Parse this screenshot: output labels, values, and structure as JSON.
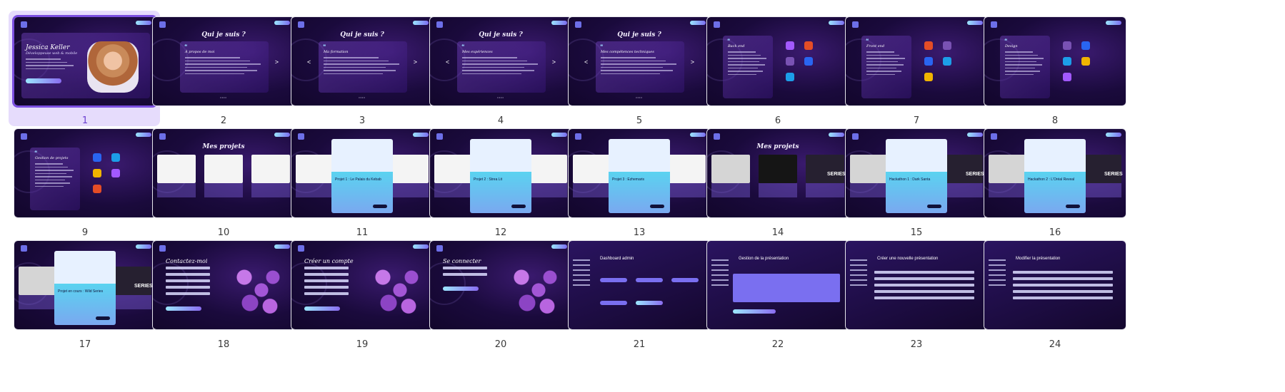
{
  "slides": [
    {
      "number": "1",
      "kind": "hero",
      "selected": true
    },
    {
      "number": "2",
      "kind": "about",
      "title": "Qui je suis ?",
      "heading": "À propos de moi"
    },
    {
      "number": "3",
      "kind": "about",
      "title": "Qui je suis ?",
      "heading": "Ma formation"
    },
    {
      "number": "4",
      "kind": "about",
      "title": "Qui je suis ?",
      "heading": "Mes expériences"
    },
    {
      "number": "5",
      "kind": "about",
      "title": "Qui je suis ?",
      "heading": "Mes compétences techniques"
    },
    {
      "number": "6",
      "kind": "skills",
      "heading": "Back end"
    },
    {
      "number": "7",
      "kind": "skills",
      "heading": "Front end"
    },
    {
      "number": "8",
      "kind": "skills",
      "heading": "Design"
    },
    {
      "number": "9",
      "kind": "skills",
      "heading": "Gestion de projets"
    },
    {
      "number": "10",
      "kind": "projects",
      "title": "Mes projets"
    },
    {
      "number": "11",
      "kind": "modal",
      "heading": "Projet 1 : Le Palais du Kebab"
    },
    {
      "number": "12",
      "kind": "modal",
      "heading": "Projet 2 : Strea Lit"
    },
    {
      "number": "13",
      "kind": "modal",
      "heading": "Projet 3 : Ezhemaris"
    },
    {
      "number": "14",
      "kind": "projects",
      "title": "Mes projets"
    },
    {
      "number": "15",
      "kind": "modal",
      "heading": "Hackathon 1 : Dark Santa"
    },
    {
      "number": "16",
      "kind": "modal",
      "heading": "Hackathon 2 : L'Oréal Reveal"
    },
    {
      "number": "17",
      "kind": "modal",
      "heading": "Projet en cours : Wild Series"
    },
    {
      "number": "18",
      "kind": "form",
      "title": "Contactez-moi"
    },
    {
      "number": "19",
      "kind": "form",
      "title": "Créer un compte"
    },
    {
      "number": "20",
      "kind": "form",
      "title": "Se connecter"
    },
    {
      "number": "21",
      "kind": "admin",
      "title": "Dashboard admin"
    },
    {
      "number": "22",
      "kind": "admin-table",
      "title": "Gestion de la présentation"
    },
    {
      "number": "23",
      "kind": "admin-form",
      "title": "Créer une nouvelle présentation"
    },
    {
      "number": "24",
      "kind": "admin-form",
      "title": "Modifier la présentation"
    }
  ],
  "hero": {
    "name": "Jessica Keller",
    "subtitle": "Développeuse web & mobile"
  },
  "projects": {
    "series_label": "SERIES"
  },
  "colors": {
    "selected_border": "#7b4fe0",
    "selected_bg": "#e6dcfc",
    "slide_bg": "#1a0a3c"
  }
}
